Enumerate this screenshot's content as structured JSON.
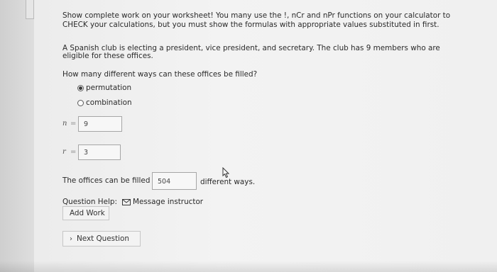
{
  "instructions": {
    "line1": "Show complete work on your worksheet! You many use the !, nCr and nPr functions on your calculator to",
    "line2": "CHECK your calculations, but you must show the formulas with appropriate values substituted in first."
  },
  "problem": {
    "line1": "A Spanish club is electing a president, vice president, and secretary. The club has 9 members who are",
    "line2": "eligible for these offices."
  },
  "question": "How many different ways can these offices be filled?",
  "options": [
    {
      "label": "permutation",
      "selected": true
    },
    {
      "label": "combination",
      "selected": false
    }
  ],
  "inputs": {
    "n": {
      "var": "n",
      "value": "9"
    },
    "r": {
      "var": "r",
      "value": "3"
    }
  },
  "answer": {
    "prefix": "The offices can be filled",
    "value": "504",
    "suffix": "different ways."
  },
  "help": {
    "label": "Question Help:",
    "message_link": "Message instructor",
    "add_work_button": "Add Work"
  },
  "next_button": "Next Question"
}
